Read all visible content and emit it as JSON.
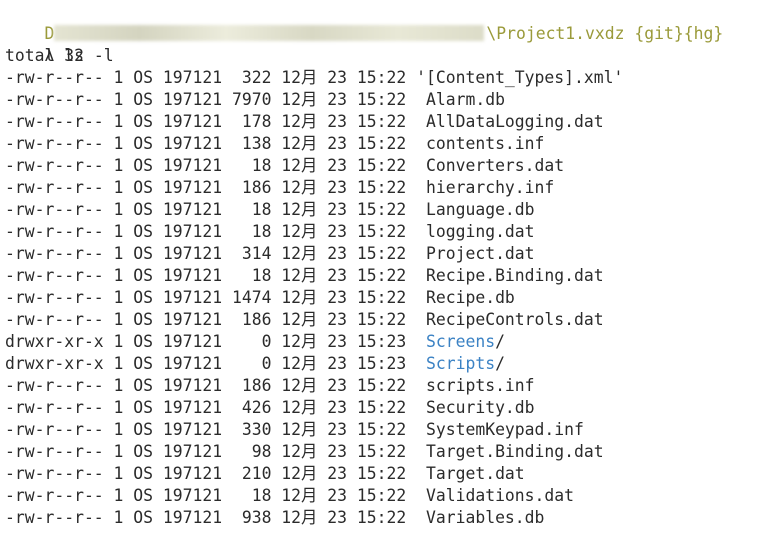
{
  "prompt": {
    "path_suffix": "\\Project1.vxdz {git}{hg}",
    "path_prefix_visible": "D"
  },
  "command": {
    "symbol": "λ",
    "text": "ls -l"
  },
  "total_line": "total 32",
  "entries": [
    {
      "perms": "-rw-r--r--",
      "links": "1",
      "owner": "OS",
      "group": "197121",
      "size": " 322",
      "month": "12月",
      "day": "23",
      "time": "15:22",
      "name": "'[Content_Types].xml'",
      "is_dir": false
    },
    {
      "perms": "-rw-r--r--",
      "links": "1",
      "owner": "OS",
      "group": "197121",
      "size": "7970",
      "month": "12月",
      "day": "23",
      "time": "15:22",
      "name": "Alarm.db",
      "is_dir": false
    },
    {
      "perms": "-rw-r--r--",
      "links": "1",
      "owner": "OS",
      "group": "197121",
      "size": " 178",
      "month": "12月",
      "day": "23",
      "time": "15:22",
      "name": "AllDataLogging.dat",
      "is_dir": false
    },
    {
      "perms": "-rw-r--r--",
      "links": "1",
      "owner": "OS",
      "group": "197121",
      "size": " 138",
      "month": "12月",
      "day": "23",
      "time": "15:22",
      "name": "contents.inf",
      "is_dir": false
    },
    {
      "perms": "-rw-r--r--",
      "links": "1",
      "owner": "OS",
      "group": "197121",
      "size": "  18",
      "month": "12月",
      "day": "23",
      "time": "15:22",
      "name": "Converters.dat",
      "is_dir": false
    },
    {
      "perms": "-rw-r--r--",
      "links": "1",
      "owner": "OS",
      "group": "197121",
      "size": " 186",
      "month": "12月",
      "day": "23",
      "time": "15:22",
      "name": "hierarchy.inf",
      "is_dir": false
    },
    {
      "perms": "-rw-r--r--",
      "links": "1",
      "owner": "OS",
      "group": "197121",
      "size": "  18",
      "month": "12月",
      "day": "23",
      "time": "15:22",
      "name": "Language.db",
      "is_dir": false
    },
    {
      "perms": "-rw-r--r--",
      "links": "1",
      "owner": "OS",
      "group": "197121",
      "size": "  18",
      "month": "12月",
      "day": "23",
      "time": "15:22",
      "name": "logging.dat",
      "is_dir": false
    },
    {
      "perms": "-rw-r--r--",
      "links": "1",
      "owner": "OS",
      "group": "197121",
      "size": " 314",
      "month": "12月",
      "day": "23",
      "time": "15:22",
      "name": "Project.dat",
      "is_dir": false
    },
    {
      "perms": "-rw-r--r--",
      "links": "1",
      "owner": "OS",
      "group": "197121",
      "size": "  18",
      "month": "12月",
      "day": "23",
      "time": "15:22",
      "name": "Recipe.Binding.dat",
      "is_dir": false
    },
    {
      "perms": "-rw-r--r--",
      "links": "1",
      "owner": "OS",
      "group": "197121",
      "size": "1474",
      "month": "12月",
      "day": "23",
      "time": "15:22",
      "name": "Recipe.db",
      "is_dir": false
    },
    {
      "perms": "-rw-r--r--",
      "links": "1",
      "owner": "OS",
      "group": "197121",
      "size": " 186",
      "month": "12月",
      "day": "23",
      "time": "15:22",
      "name": "RecipeControls.dat",
      "is_dir": false
    },
    {
      "perms": "drwxr-xr-x",
      "links": "1",
      "owner": "OS",
      "group": "197121",
      "size": "   0",
      "month": "12月",
      "day": "23",
      "time": "15:23",
      "name": "Screens",
      "is_dir": true
    },
    {
      "perms": "drwxr-xr-x",
      "links": "1",
      "owner": "OS",
      "group": "197121",
      "size": "   0",
      "month": "12月",
      "day": "23",
      "time": "15:23",
      "name": "Scripts",
      "is_dir": true
    },
    {
      "perms": "-rw-r--r--",
      "links": "1",
      "owner": "OS",
      "group": "197121",
      "size": " 186",
      "month": "12月",
      "day": "23",
      "time": "15:22",
      "name": "scripts.inf",
      "is_dir": false
    },
    {
      "perms": "-rw-r--r--",
      "links": "1",
      "owner": "OS",
      "group": "197121",
      "size": " 426",
      "month": "12月",
      "day": "23",
      "time": "15:22",
      "name": "Security.db",
      "is_dir": false
    },
    {
      "perms": "-rw-r--r--",
      "links": "1",
      "owner": "OS",
      "group": "197121",
      "size": " 330",
      "month": "12月",
      "day": "23",
      "time": "15:22",
      "name": "SystemKeypad.inf",
      "is_dir": false
    },
    {
      "perms": "-rw-r--r--",
      "links": "1",
      "owner": "OS",
      "group": "197121",
      "size": "  98",
      "month": "12月",
      "day": "23",
      "time": "15:22",
      "name": "Target.Binding.dat",
      "is_dir": false
    },
    {
      "perms": "-rw-r--r--",
      "links": "1",
      "owner": "OS",
      "group": "197121",
      "size": " 210",
      "month": "12月",
      "day": "23",
      "time": "15:22",
      "name": "Target.dat",
      "is_dir": false
    },
    {
      "perms": "-rw-r--r--",
      "links": "1",
      "owner": "OS",
      "group": "197121",
      "size": "  18",
      "month": "12月",
      "day": "23",
      "time": "15:22",
      "name": "Validations.dat",
      "is_dir": false
    },
    {
      "perms": "-rw-r--r--",
      "links": "1",
      "owner": "OS",
      "group": "197121",
      "size": " 938",
      "month": "12月",
      "day": "23",
      "time": "15:22",
      "name": "Variables.db",
      "is_dir": false
    }
  ],
  "dir_suffix": "/",
  "colors": {
    "text": "#2b2b2b",
    "prompt_path": "#9a9a3a",
    "directory": "#3b82c4",
    "background": "#ffffff"
  }
}
